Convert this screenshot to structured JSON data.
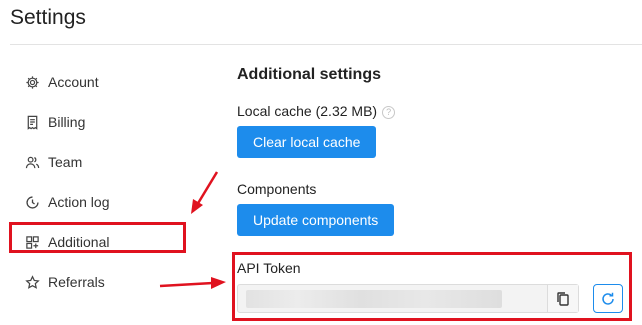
{
  "page": {
    "title": "Settings"
  },
  "sidebar": {
    "items": [
      {
        "label": "Account",
        "icon": "gear-icon"
      },
      {
        "label": "Billing",
        "icon": "receipt-icon"
      },
      {
        "label": "Team",
        "icon": "users-icon"
      },
      {
        "label": "Action log",
        "icon": "clock-icon"
      },
      {
        "label": "Additional",
        "icon": "grid-icon"
      },
      {
        "label": "Referrals",
        "icon": "star-icon"
      }
    ]
  },
  "main": {
    "heading": "Additional settings",
    "local_cache_label": "Local cache (2.32 MB)",
    "local_cache_hint": "?",
    "clear_cache_button": "Clear local cache",
    "components_label": "Components",
    "update_components_button": "Update components",
    "api_token_label": "API Token"
  },
  "colors": {
    "accent": "#1d8cec",
    "annotation": "#e0121f"
  }
}
